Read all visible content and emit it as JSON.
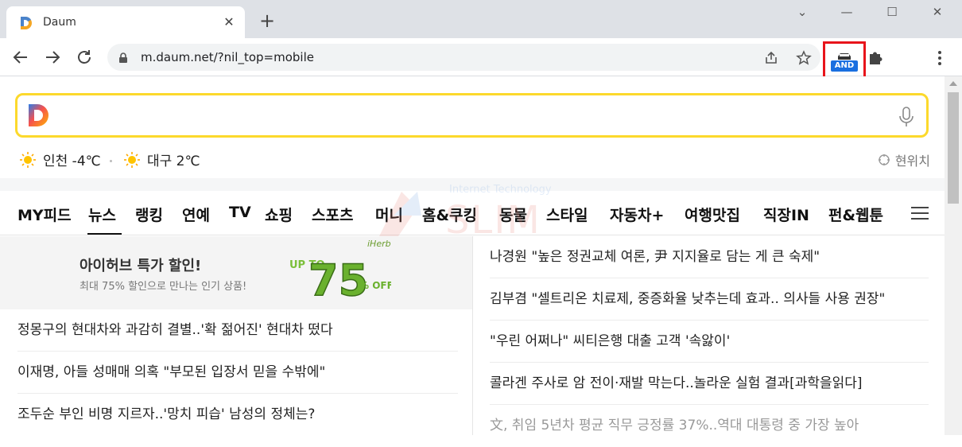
{
  "browser": {
    "tab_title": "Daum",
    "url": "m.daum.net/?nil_top=mobile",
    "extension_badge": "AND"
  },
  "weather": {
    "item1": "인천 -4℃",
    "item2": "대구 2℃",
    "location_label": "현위치"
  },
  "nav": {
    "items": [
      "MY피드",
      "뉴스",
      "랭킹",
      "연예",
      "TV",
      "쇼핑",
      "스포츠",
      "머니",
      "홈&쿠킹",
      "동물",
      "스타일",
      "자동차+",
      "여행맛집",
      "직장IN",
      "펀&웹툰"
    ],
    "active": "뉴스"
  },
  "ad": {
    "brand": "iHerb",
    "title": "아이허브 특가 할인!",
    "subtitle": "최대 75% 할인으로 만나는 인기 상품!",
    "badge_prefix": "UP TO",
    "badge_value": "75",
    "badge_suffix": "% OFF"
  },
  "news_left": [
    "정몽구의 현대차와 과감히 결별..'확 젊어진' 현대차 떴다",
    "이재명, 아들 성매매 의혹 \"부모된 입장서 믿을 수밖에\"",
    "조두순 부인 비명 지르자..'망치 피습' 남성의 정체는?"
  ],
  "news_right": [
    "나경원 \"높은 정권교체 여론, 尹 지지율로 담는 게 큰 숙제\"",
    "김부겸 \"셀트리온 치료제, 중증화율 낮추는데 효과.. 의사들 사용 권장\"",
    "\"우린 어쩌나\" 씨티은행 대출 고객 '속앓이'",
    "콜라겐 주사로 암 전이·재발 막는다..놀라운 실험 결과[과학을읽다]",
    "文, 취임 5년차 평균 직무 긍정률 37%..역대 대통령 중 가장 높아"
  ],
  "watermark": {
    "line1": "Internet Technology",
    "line2": "SLIM"
  },
  "colors": {
    "search_border": "#fcd92c",
    "highlight_box": "#e8141b",
    "extension_blue": "#1a6fe0"
  }
}
